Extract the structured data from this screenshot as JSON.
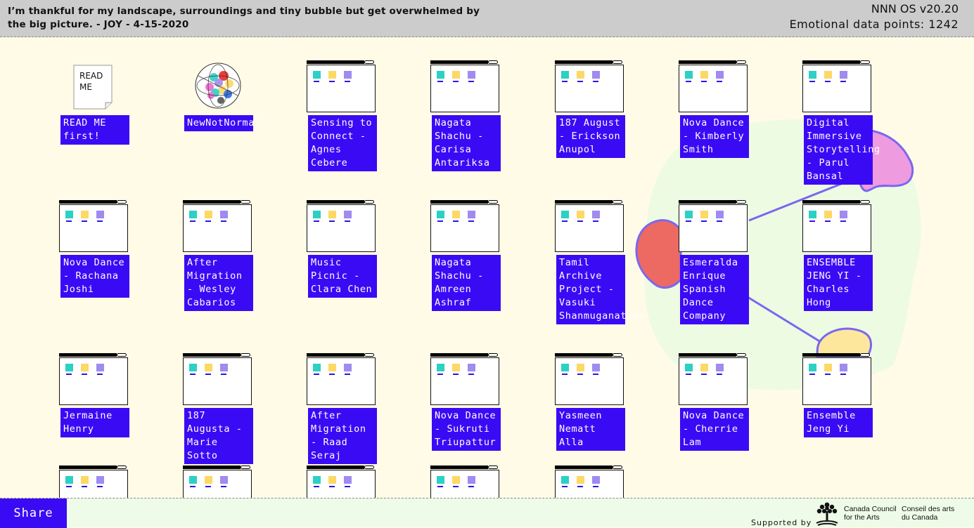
{
  "header": {
    "quote": "I’m thankful for my landscape, surroundings and tiny bubble but get overwhelmed by the big picture. - JOY - 4-15-2020",
    "os_name": "NNN OS v20.20",
    "datapoints": "Emotional data points: 1242"
  },
  "icons": [
    {
      "type": "readme",
      "label": "READ ME first!",
      "doc_text": "READ ME"
    },
    {
      "type": "logo",
      "label": "NewNotNormal"
    },
    {
      "type": "window",
      "label": "Sensing to Connect - Agnes Cebere"
    },
    {
      "type": "window",
      "label": "Nagata Shachu - Carisa Antariksa"
    },
    {
      "type": "window",
      "label": "187 August - Erickson Anupol"
    },
    {
      "type": "window",
      "label": "Nova Dance - Kimberly Smith"
    },
    {
      "type": "window",
      "label": "Digital Immersive Storytelling - Parul Bansal"
    },
    {
      "type": "window",
      "label": "Nova Dance - Rachana Joshi"
    },
    {
      "type": "window",
      "label": "After Migration - Wesley Cabarios"
    },
    {
      "type": "window",
      "label": "Music Picnic - Clara Chen"
    },
    {
      "type": "window",
      "label": "Nagata Shachu - Amreen Ashraf"
    },
    {
      "type": "window",
      "label": "Tamil Archive Project - Vasuki Shanmuganathan"
    },
    {
      "type": "window",
      "label": "Esmeralda Enrique Spanish Dance Company"
    },
    {
      "type": "window",
      "label": "ENSEMBLE JENG YI - Charles Hong"
    },
    {
      "type": "window",
      "label": "Jermaine Henry"
    },
    {
      "type": "window",
      "label": "187 Augusta - Marie Sotto"
    },
    {
      "type": "window",
      "label": "After Migration - Raad Seraj"
    },
    {
      "type": "window",
      "label": "Nova Dance - Sukruti Triupattur"
    },
    {
      "type": "window",
      "label": "Yasmeen Nematt Alla"
    },
    {
      "type": "window",
      "label": "Nova Dance - Cherrie Lam"
    },
    {
      "type": "window",
      "label": "Ensemble Jeng Yi"
    },
    {
      "type": "window",
      "label": ""
    },
    {
      "type": "window",
      "label": ""
    },
    {
      "type": "window",
      "label": ""
    },
    {
      "type": "window",
      "label": ""
    },
    {
      "type": "window",
      "label": ""
    }
  ],
  "window_square_colors": [
    "#2ad1c4",
    "#fcd964",
    "#a18af0"
  ],
  "colors": {
    "accent": "#3b0af5",
    "background": "#fffbe6"
  },
  "footer": {
    "share_label": "Share",
    "supported_by": "Supported by",
    "cc_en": "Canada Council\nfor the Arts",
    "cc_fr": "Conseil des arts\ndu Canada"
  }
}
